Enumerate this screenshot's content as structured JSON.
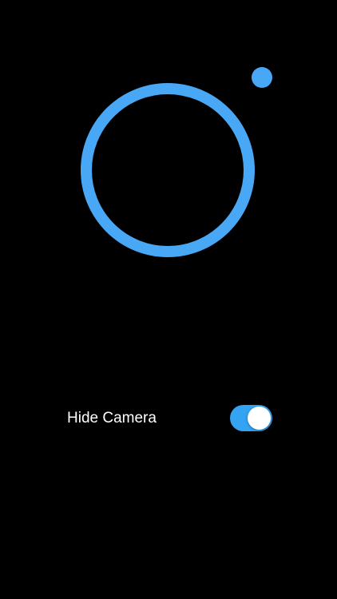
{
  "camera_view": {
    "ring_icon": "camera-ring-icon",
    "indicator_icon": "indicator-dot-icon",
    "accent_color": "#49a8f5"
  },
  "settings": {
    "hide_camera": {
      "label": "Hide Camera",
      "enabled": true,
      "toggle_color": "#33a3f2"
    }
  }
}
